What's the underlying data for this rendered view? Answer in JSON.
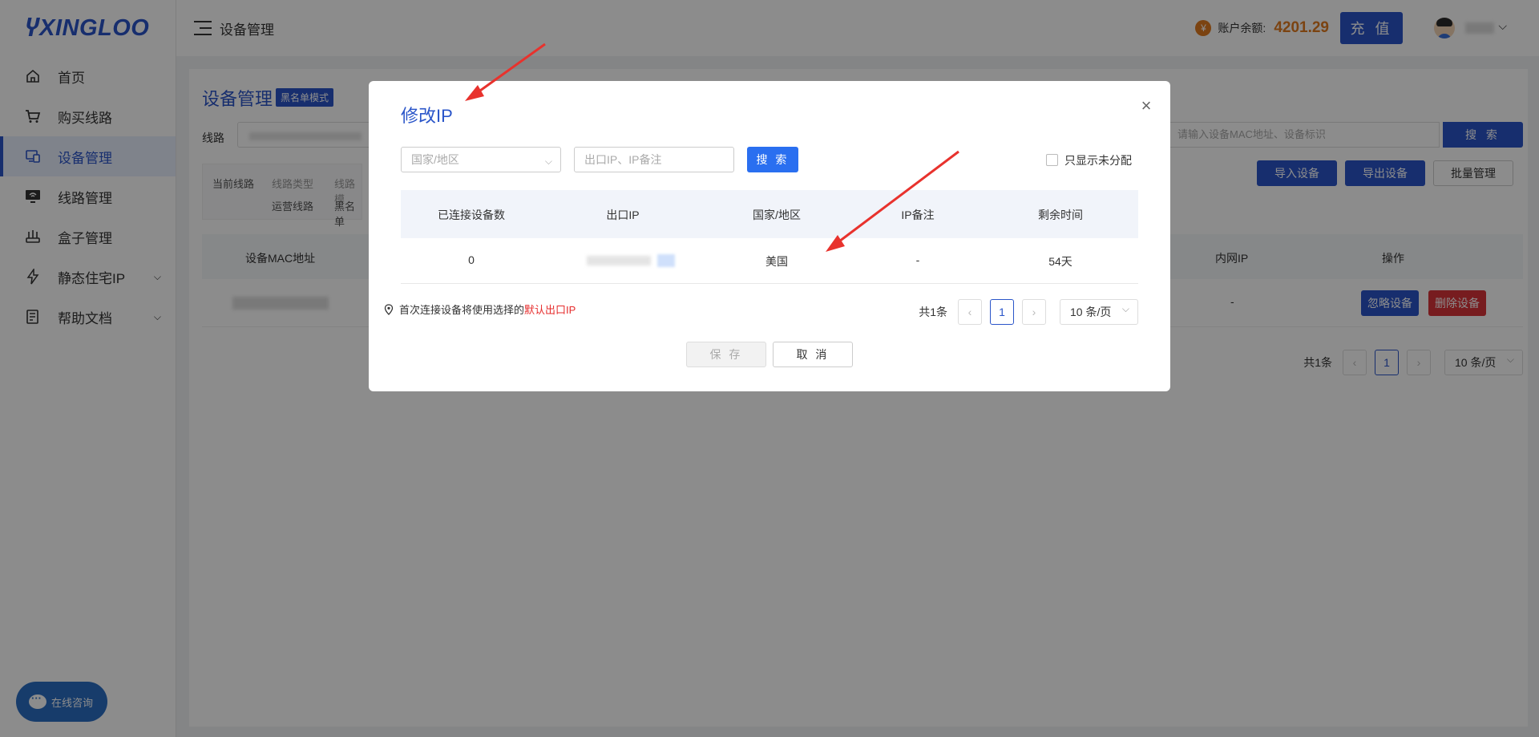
{
  "brand": {
    "name": "XINGLOO"
  },
  "sidebar": {
    "items": [
      {
        "label": "首页",
        "icon": "home-icon"
      },
      {
        "label": "购买线路",
        "icon": "cart-icon"
      },
      {
        "label": "设备管理",
        "icon": "device-icon",
        "active": true
      },
      {
        "label": "线路管理",
        "icon": "wifi-monitor-icon"
      },
      {
        "label": "盒子管理",
        "icon": "router-icon"
      },
      {
        "label": "静态住宅IP",
        "icon": "bolt-icon",
        "expandable": true
      },
      {
        "label": "帮助文档",
        "icon": "doc-icon",
        "expandable": true
      }
    ]
  },
  "header": {
    "title": "设备管理",
    "balance_label": "账户余额:",
    "balance_value": "4201.29",
    "coin_symbol": "¥",
    "recharge_label": "充 值"
  },
  "page": {
    "title": "设备管理",
    "mode_badge": "黑名单模式",
    "line_label": "线路",
    "filters": {
      "current_line": "当前线路",
      "line_type": "线路类型",
      "line_mode": "线路模",
      "operating_line": "运营线路",
      "blacklist": "黑名单"
    },
    "search_placeholder": "请输入设备MAC地址、设备标识",
    "search_label": "搜 索",
    "import_label": "导入设备",
    "export_label": "导出设备",
    "batch_label": "批量管理",
    "table_headers": {
      "mac": "设备MAC地址",
      "lan_ip": "内网IP",
      "actions": "操作"
    },
    "row": {
      "lan_ip": "-",
      "ignore_label": "忽略设备",
      "delete_label": "删除设备"
    },
    "pager": {
      "total": "共1条",
      "current": "1",
      "size": "10 条/页"
    }
  },
  "chat": {
    "label": "在线咨询"
  },
  "modal": {
    "title": "修改IP",
    "region_placeholder": "国家/地区",
    "ip_placeholder": "出口IP、IP备注",
    "search_label": "搜 索",
    "only_unassigned_label": "只显示未分配",
    "columns": [
      "已连接设备数",
      "出口IP",
      "国家/地区",
      "IP备注",
      "剩余时间"
    ],
    "rows": [
      {
        "connected": "0",
        "exit_ip": "",
        "region": "美国",
        "ip_note": "-",
        "remaining": "54天"
      }
    ],
    "note_prefix": "首次连接设备将使用选择的",
    "note_highlight": "默认出口IP",
    "pager": {
      "total": "共1条",
      "current": "1",
      "size": "10 条/页"
    },
    "save_label": "保 存",
    "cancel_label": "取 消"
  },
  "colors": {
    "brand": "#2a55c9",
    "balance": "#e07a1f",
    "danger": "#d9343a",
    "highlight": "#e62c2c",
    "arrow": "#e8322d"
  }
}
